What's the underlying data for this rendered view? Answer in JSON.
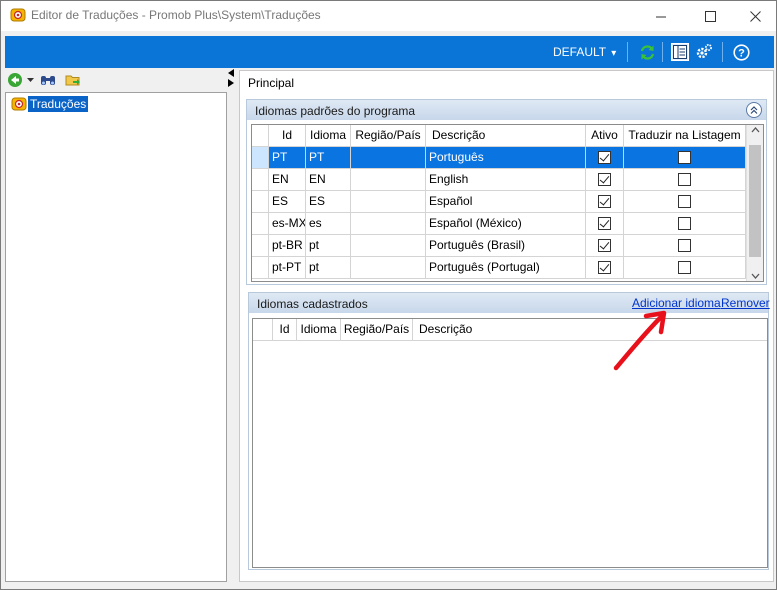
{
  "window": {
    "title": "Editor de Traduções - Promob Plus\\System\\Traduções"
  },
  "toolbar": {
    "profile_label": "DEFAULT",
    "dropdown_glyph": "▾"
  },
  "tree": {
    "root_label": "Traduções"
  },
  "main": {
    "header": "Principal"
  },
  "default_languages": {
    "title": "Idiomas padrões do programa",
    "columns": [
      "Id",
      "Idioma",
      "Região/País",
      "Descrição",
      "Ativo",
      "Traduzir na Listagem"
    ],
    "rows": [
      {
        "id": "PT",
        "idioma": "PT",
        "regiao": "",
        "descricao": "Português",
        "ativo": true,
        "traduzir": false,
        "selected": true
      },
      {
        "id": "EN",
        "idioma": "EN",
        "regiao": "",
        "descricao": "English",
        "ativo": true,
        "traduzir": false,
        "selected": false
      },
      {
        "id": "ES",
        "idioma": "ES",
        "regiao": "",
        "descricao": "Español",
        "ativo": true,
        "traduzir": false,
        "selected": false
      },
      {
        "id": "es-MX",
        "idioma": "es",
        "regiao": "",
        "descricao": "Español (México)",
        "ativo": true,
        "traduzir": false,
        "selected": false
      },
      {
        "id": "pt-BR",
        "idioma": "pt",
        "regiao": "",
        "descricao": "Português (Brasil)",
        "ativo": true,
        "traduzir": false,
        "selected": false
      },
      {
        "id": "pt-PT",
        "idioma": "pt",
        "regiao": "",
        "descricao": "Português (Portugal)",
        "ativo": true,
        "traduzir": false,
        "selected": false
      }
    ]
  },
  "registered_languages": {
    "title": "Idiomas cadastrados",
    "add_link": "Adicionar idioma",
    "remove_link": "Remover",
    "columns": [
      "Id",
      "Idioma",
      "Região/País",
      "Descrição"
    ]
  },
  "colors": {
    "toolbar_blue": "#0b74d7",
    "selection_blue": "#0a74e0",
    "annotation_red": "#e8101b"
  },
  "icons": [
    "app-icon",
    "minimize-icon",
    "maximize-icon",
    "close-icon",
    "refresh-icon",
    "layout-icon",
    "settings-icon",
    "help-icon",
    "back-icon",
    "find-icon",
    "folder-icon",
    "translation-node-icon"
  ]
}
